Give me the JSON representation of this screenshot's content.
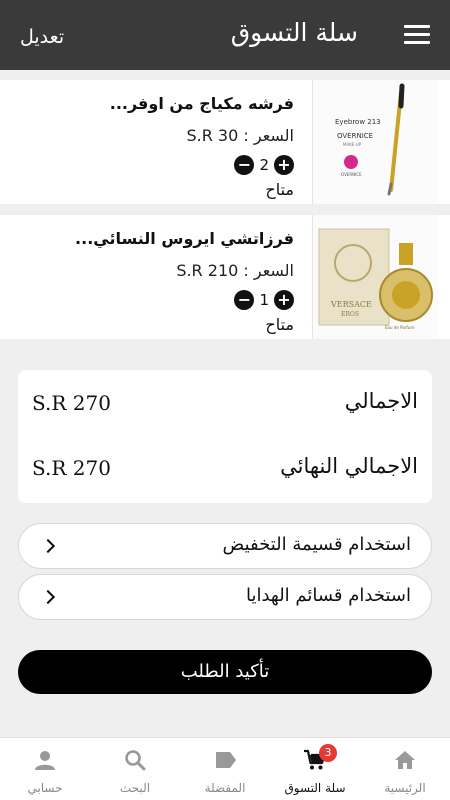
{
  "header": {
    "title": "سلة التسوق",
    "edit_label": "تعديل"
  },
  "items": [
    {
      "name": "فرشه مكياج من اوفر...",
      "price": "السعر : S.R 30",
      "quantity": "2",
      "status": "متاح",
      "image": {
        "line1": "Eyebrow 213",
        "line2": "OVERNICE",
        "line3": "MAKE-UP",
        "line4": "OVERNICE"
      }
    },
    {
      "name": "فرزاتشي ايروس النسائي...",
      "price": "السعر : S.R 210",
      "quantity": "1",
      "status": "متاح",
      "image": {
        "line1": "VERSACE",
        "line2": "EROS",
        "line3": "Eau de Parfum"
      }
    }
  ],
  "totals": {
    "total_label": "الاجمالي",
    "total_value": "S.R 270",
    "final_label": "الاجمالي النهائي",
    "final_value": "S.R 270"
  },
  "options": {
    "discount_label": "استخدام قسيمة التخفيض",
    "gift_label": "استخدام قسائم الهدايا"
  },
  "confirm_label": "تأكيد الطلب",
  "tabs": {
    "home": "الرئيسية",
    "cart": "سلة التسوق",
    "cart_badge": "3",
    "favorites": "المفضلة",
    "search": "البحث",
    "account": "حسابي"
  },
  "colors": {
    "header_bg": "#3a3a3a",
    "accent": "#000000",
    "badge": "#e53935"
  }
}
